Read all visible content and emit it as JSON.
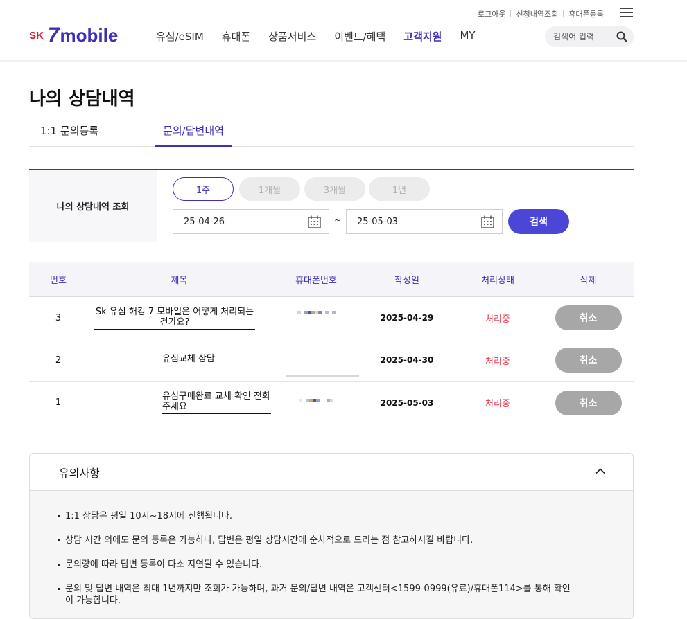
{
  "header": {
    "util_links": [
      "로그아웃",
      "신청내역조회",
      "휴대폰등록"
    ],
    "logo": {
      "sk": "SK",
      "seven": "7",
      "mobile": "mobile"
    },
    "nav": [
      "유심/eSIM",
      "휴대폰",
      "상품서비스",
      "이벤트/혜택",
      "고객지원",
      "MY"
    ],
    "active_nav": "고객지원",
    "search_placeholder": "검색어 입력"
  },
  "page_title": "나의 상담내역",
  "tabs": [
    "1:1 문의등록",
    "문의/답변내역"
  ],
  "filter": {
    "label": "나의 상담내역 조회",
    "periods": [
      "1주",
      "1개월",
      "3개월",
      "1년"
    ],
    "start_date": "25-04-26",
    "tilde": "~",
    "end_date": "25-05-03",
    "search_label": "검색"
  },
  "table": {
    "headers": [
      "번호",
      "제목",
      "휴대폰번호",
      "작성일",
      "처리상태",
      "삭제"
    ],
    "rows": [
      {
        "no": "3",
        "title": "Sk 유심 해킹 7 모바일은 어떻게 처리되는건가요?",
        "date": "2025-04-29",
        "status": "처리중",
        "action": "취소"
      },
      {
        "no": "2",
        "title": "유심교체 상담",
        "date": "2025-04-30",
        "status": "처리중",
        "action": "취소"
      },
      {
        "no": "1",
        "title": "유심구매완료 교체 확인 전화 주세요",
        "date": "2025-05-03",
        "status": "처리중",
        "action": "취소"
      }
    ]
  },
  "notice": {
    "title": "유의사항",
    "items": [
      "1:1 상담은 평일 10시~18시에 진행됩니다.",
      "상담 시간 외에도 문의 등록은 가능하나, 답변은 평일 상담시간에 순차적으로 드리는 점 참고하시길 바랍니다.",
      "문의량에 따라 답변 등록이 다소 지연될 수 있습니다.",
      "문의 및 답변 내역은 최대 1년까지만 조회가 가능하며, 과거 문의/답변 내역은 고객센터<1599-0999(유료)/휴대폰114>를 통해 확인이 가능합니다."
    ]
  },
  "colors": {
    "brand": "#3d2fb8",
    "accent_red": "#e8112d",
    "search_button": "#4b46d6",
    "status": "#e23a4e"
  }
}
